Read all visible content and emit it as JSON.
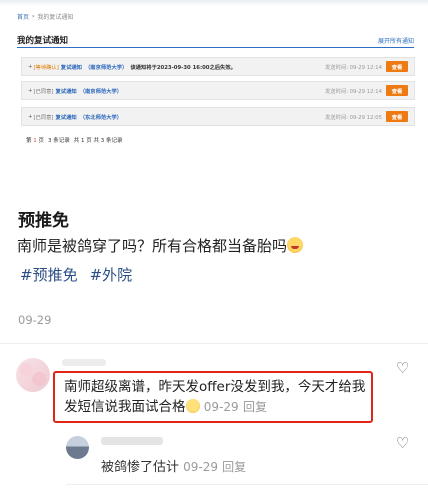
{
  "notice": {
    "breadcrumb": {
      "home": "首页",
      "sep": "›",
      "current": "我的复试通知"
    },
    "title": "我的复试通知",
    "expand_all": "展开所有通知",
    "rows": [
      {
        "plus": "+",
        "status": "[等待确认]",
        "type": "复试通知",
        "school": "（南京师范大学）",
        "message": "该通知将于2023-09-30 16:00之后失效。",
        "time": "发送时间:  09-29 12:14",
        "button": "查看"
      },
      {
        "plus": "+",
        "status": "[已同意]",
        "type": "复试通知",
        "school": "（南京师范大学）",
        "message": "",
        "time": "发送时间:  09-29 12:14",
        "button": "查看"
      },
      {
        "plus": "+",
        "status": "[已同意]",
        "type": "复试通知",
        "school": "（东北师范大学）",
        "message": "",
        "time": "发送时间:  09-29 12:05",
        "button": "查看"
      }
    ],
    "pager": {
      "page_prefix": "第",
      "page_num": "1",
      "page_suffix": "页",
      "records": "3 条记录",
      "total": "共 1 页 共 3 条记录"
    }
  },
  "post": {
    "title": "预推免",
    "body": "南师是被鸽穿了吗？所有合格都当备胎吗",
    "body_emoji": "clown-face-icon",
    "tags": [
      "#预推免",
      "#外院"
    ],
    "date": "09-29"
  },
  "comments": [
    {
      "text": "南师超级离谱，昨天发offer没发到我，今天才给我发短信说我面试合格",
      "emoji": "clown-face-icon",
      "date": "09-29",
      "reply": "回复",
      "highlighted": true
    },
    {
      "text": "被鸽惨了估计",
      "date": "09-29",
      "reply": "回复"
    }
  ],
  "colors": {
    "link_blue": "#2b68bd",
    "orange_button": "#f07a12",
    "status_orange": "#e07a00",
    "highlight_red": "#e02418",
    "tag_blue": "#2b4f86"
  }
}
